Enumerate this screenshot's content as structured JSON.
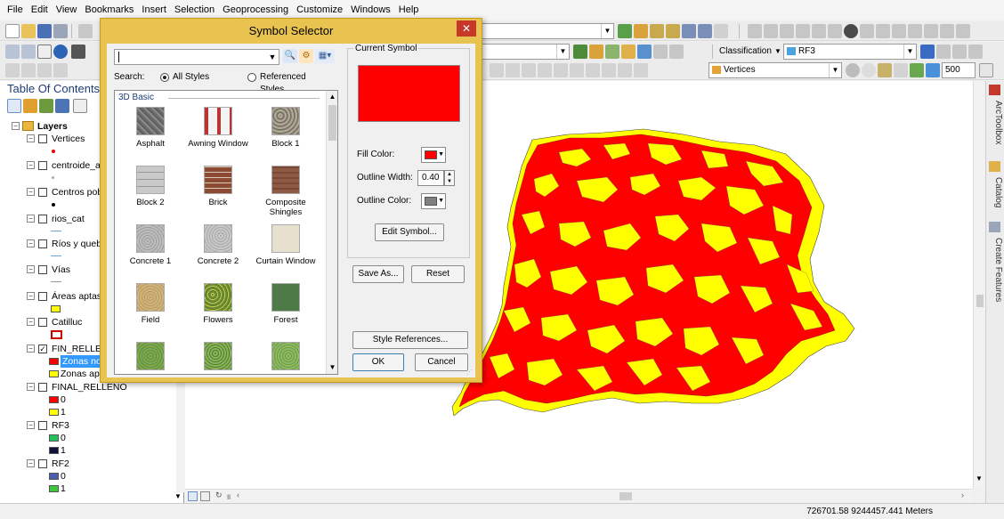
{
  "menu": [
    "File",
    "Edit",
    "View",
    "Bookmarks",
    "Insert",
    "Selection",
    "Geoprocessing",
    "Customize",
    "Windows",
    "Help"
  ],
  "toolbar": {
    "classification_label": "Classification",
    "layer_combo": "RF3",
    "editor_layer_combo": "Vertices",
    "scale_value": "500"
  },
  "toc": {
    "title": "Table Of Contents",
    "root": "Layers",
    "layers": [
      {
        "name": "Vertices",
        "checked": false
      },
      {
        "name": "centroide_as",
        "checked": false
      },
      {
        "name": "Centros pobl",
        "checked": false
      },
      {
        "name": "rios_cat",
        "checked": false
      },
      {
        "name": "Ríos y quebra",
        "checked": false
      },
      {
        "name": "Vías",
        "checked": false
      },
      {
        "name": "Áreas aptas",
        "checked": false
      },
      {
        "name": "Catilluc",
        "checked": false
      },
      {
        "name": "FIN_RELLENO",
        "checked": true
      },
      {
        "name": "FINAL_RELLENO",
        "checked": false
      },
      {
        "name": "RF3",
        "checked": false
      },
      {
        "name": "RF2",
        "checked": false
      }
    ],
    "legend": {
      "fin_relleno_1": "Zonas no",
      "fin_relleno_2": "Zonas apt",
      "final_relleno_0": "0",
      "final_relleno_1": "1",
      "rf3_0": "0",
      "rf3_1": "1",
      "rf2_0": "0",
      "rf2_1": "1"
    }
  },
  "dialog": {
    "title": "Symbol Selector",
    "close": "✕",
    "search_value": "",
    "search_label": "Search:",
    "radio_all": "All Styles",
    "radio_ref": "Referenced Styles",
    "group": "3D Basic",
    "symbols": [
      "Asphalt",
      "Awning Window",
      "Block 1",
      "Block 2",
      "Brick",
      "Composite Shingles",
      "Concrete 1",
      "Concrete 2",
      "Curtain Window",
      "Field",
      "Flowers",
      "Forest"
    ],
    "current_symbol_label": "Current Symbol",
    "fill_color_label": "Fill Color:",
    "outline_width_label": "Outline Width:",
    "outline_width_value": "0.40",
    "outline_color_label": "Outline Color:",
    "edit_symbol": "Edit Symbol...",
    "save_as": "Save As...",
    "reset": "Reset",
    "style_references": "Style References...",
    "ok": "OK",
    "cancel": "Cancel"
  },
  "dock_tabs": [
    "ArcToolbox",
    "Catalog",
    "Create Features"
  ],
  "status": {
    "coordinates": "726701.58  9244457.441 Meters"
  },
  "colors": {
    "red": "#ff0000",
    "yellow": "#ffff00",
    "outline_gray": "#808080",
    "dialog_frame": "#e9c34f",
    "title_blue": "#1e3c78"
  }
}
